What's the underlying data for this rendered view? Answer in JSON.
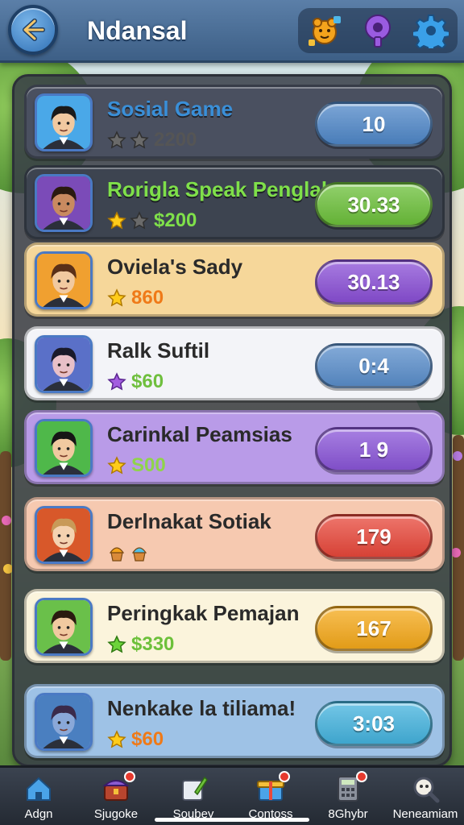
{
  "header": {
    "title": "Ndansal",
    "icons": [
      "back-arrow-icon",
      "puzzle-pet-icon",
      "purple-key-icon",
      "gear-icon"
    ]
  },
  "leaderboard": [
    {
      "name": "Sosial Game",
      "score_text": "2200",
      "value": "10",
      "stars": 2,
      "star_icon": "gray-star",
      "name_color": "#3a8fd8",
      "score_color": "#555555",
      "row_bg": "#4a5060",
      "btn_color": "#4f87c8"
    },
    {
      "name": "Rorigla Speak Penglal",
      "score_text": "$200",
      "value": "30.33",
      "stars": 2,
      "star_icon": "gold-star",
      "name_color": "#7fe04a",
      "score_color": "#7fe04a",
      "row_bg": "#3d4450",
      "btn_color": "#6cc03a"
    },
    {
      "name": "Oviela's Sady",
      "score_text": "860",
      "value": "30.13",
      "stars": 1,
      "star_icon": "gold-star",
      "name_color": "#2a2a2a",
      "score_color": "#ef7a18",
      "row_bg": "#f6d79a",
      "btn_color": "#8a4fd6"
    },
    {
      "name": "Ralk Suftil",
      "score_text": "$60",
      "value": "0:4",
      "stars": 1,
      "star_icon": "purple-star",
      "name_color": "#2a2a2a",
      "score_color": "#6fbf3e",
      "row_bg": "#f3f4f8",
      "btn_color": "#5a8ecb"
    },
    {
      "name": "Carinkal Peamsias",
      "score_text": "S00",
      "value": "1 9",
      "stars": 1,
      "star_icon": "gold-star",
      "name_color": "#2a2a2a",
      "score_color": "#8fd44a",
      "row_bg": "#b99be8",
      "btn_color": "#8a55d8"
    },
    {
      "name": "Derlnakat Sotiak",
      "score_text": "",
      "value": "179",
      "stars": 0,
      "star_icon": "cupcake",
      "name_color": "#2a2a2a",
      "score_color": "#ef7a18",
      "row_bg": "#f6c9b0",
      "btn_color": "#e8473a"
    },
    {
      "name": "Peringkak Pemajan",
      "score_text": "$330",
      "value": "167",
      "stars": 1,
      "star_icon": "green-star",
      "name_color": "#2a2a2a",
      "score_color": "#6cc03a",
      "row_bg": "#fbf4dc",
      "btn_color": "#f5a91a"
    },
    {
      "name": "Nenkake la tiliama!",
      "score_text": "$60",
      "value": "3:03",
      "stars": 1,
      "star_icon": "gold-star",
      "name_color": "#2a2a2a",
      "score_color": "#ef7a18",
      "row_bg": "#9ec2e6",
      "btn_color": "#44b3de"
    }
  ],
  "nav": [
    {
      "label": "Adgn",
      "icon": "house-icon",
      "badge": false
    },
    {
      "label": "Sjugoke",
      "icon": "treasure-chest-icon",
      "badge": true
    },
    {
      "label": "Soubey",
      "icon": "notepad-pencil-icon",
      "badge": false
    },
    {
      "label": "Contoss",
      "icon": "gift-box-icon",
      "badge": true
    },
    {
      "label": "8Ghybr",
      "icon": "calculator-icon",
      "badge": true
    },
    {
      "label": "Neneamiam",
      "icon": "magnifier-icon",
      "badge": false
    }
  ]
}
